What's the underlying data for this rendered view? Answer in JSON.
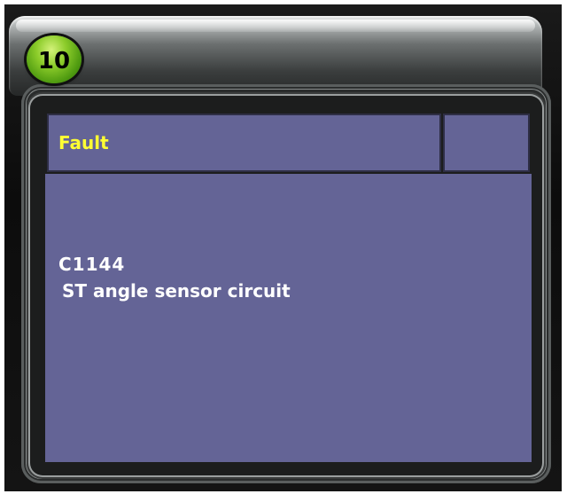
{
  "step": {
    "number": "10"
  },
  "header": {
    "title": "Fault"
  },
  "fault": {
    "code": "C1144",
    "description": "ST angle sensor circuit"
  },
  "colors": {
    "panel_background": "#646496",
    "header_text": "#ffff33",
    "body_text": "#ffffff",
    "badge_green": "#6fb81c"
  }
}
